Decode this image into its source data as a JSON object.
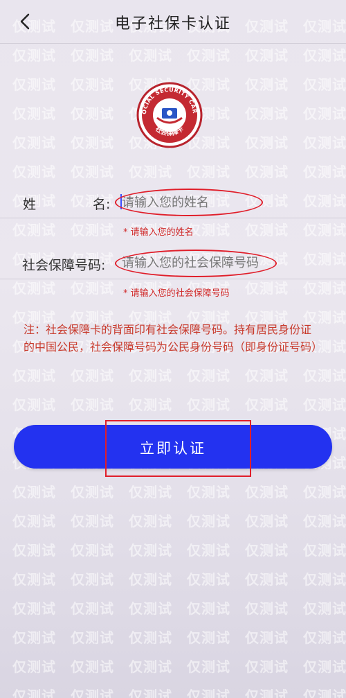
{
  "header": {
    "title": "电子社保卡认证"
  },
  "logo": {
    "top_text": "SOCIAL SECURITY CARD",
    "bottom_text": "社会保障卡"
  },
  "form": {
    "name_label_1": "姓",
    "name_label_2": "名:",
    "name_placeholder": "请输入您的姓名",
    "name_error": "* 请输入您的姓名",
    "id_label": "社会保障号码:",
    "id_placeholder": "请输入您的社会保障号码",
    "id_error": "* 请输入您的社会保障号码"
  },
  "note": "注：社会保障卡的背面印有社会保障号码。持有居民身份证的中国公民，社会保障号码为公民身份号码（即身份证号码）",
  "submit_label": "立即认证",
  "watermark_text": "仅测试",
  "colors": {
    "accent": "#2332f0",
    "error": "#d02a2a",
    "annotation": "#e01e2a"
  }
}
